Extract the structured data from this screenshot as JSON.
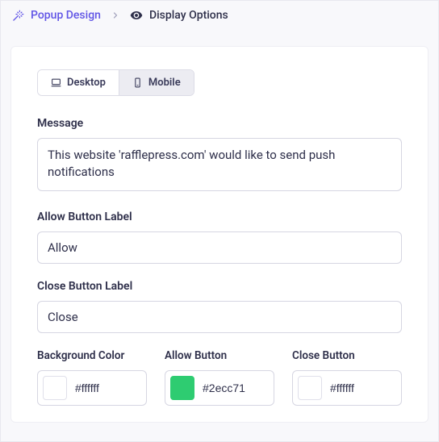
{
  "breadcrumb": {
    "parent": "Popup Design",
    "current": "Display Options"
  },
  "tabs": {
    "desktop": "Desktop",
    "mobile": "Mobile"
  },
  "fields": {
    "message": {
      "label": "Message",
      "value": "This website 'rafflepress.com' would like to send push notifications"
    },
    "allow": {
      "label": "Allow Button Label",
      "value": "Allow"
    },
    "close": {
      "label": "Close Button Label",
      "value": "Close"
    }
  },
  "colors": {
    "background": {
      "label": "Background Color",
      "hex": "#ffffff"
    },
    "allow_button": {
      "label": "Allow Button",
      "hex": "#2ecc71"
    },
    "close_button": {
      "label": "Close Button",
      "hex": "#ffffff"
    }
  }
}
